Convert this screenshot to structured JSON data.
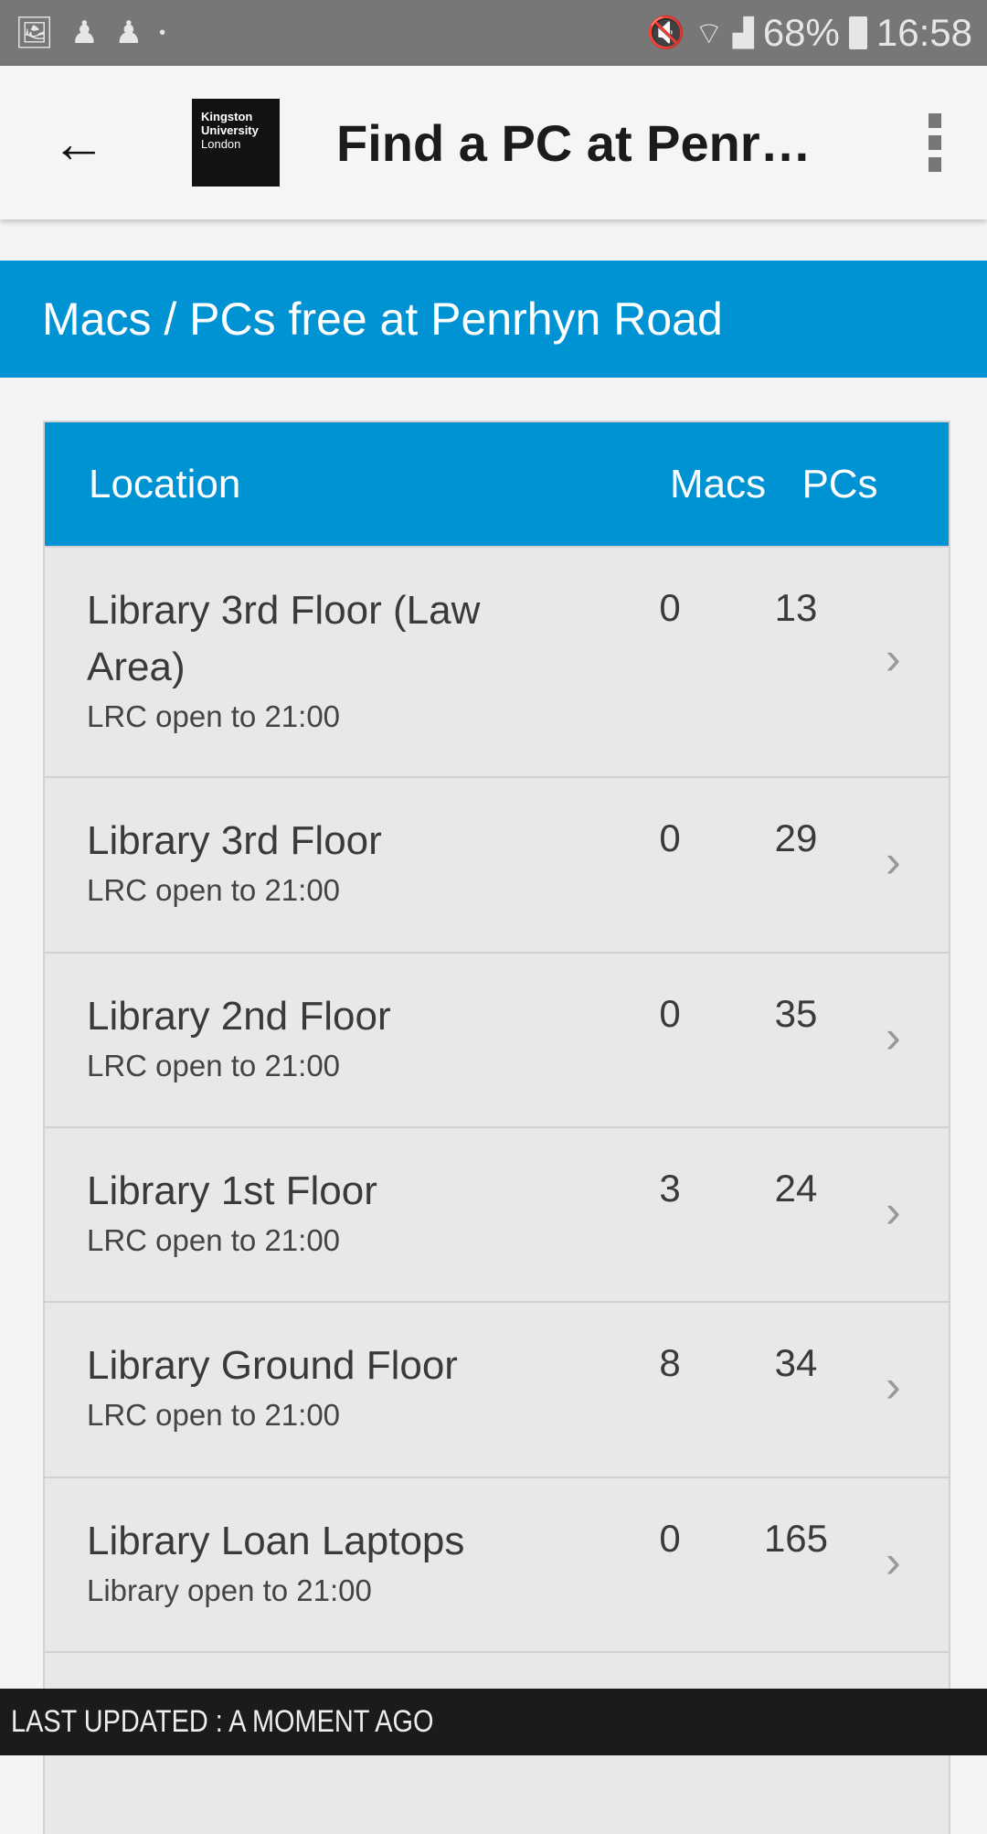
{
  "status_bar": {
    "battery": "68%",
    "time": "16:58",
    "icons": [
      "image-icon",
      "keyhole-icon",
      "keyhole-icon",
      "dot-icon",
      "mute-icon",
      "wifi-icon",
      "signal-icon",
      "battery-icon"
    ]
  },
  "app_bar": {
    "title": "Find a PC at Penrhyn Road",
    "logo": [
      "Kingston",
      "University",
      "London"
    ]
  },
  "banner": "Macs / PCs free at Penrhyn Road",
  "table": {
    "headers": {
      "location": "Location",
      "macs": "Macs",
      "pcs": "PCs"
    },
    "rows": [
      {
        "name": "Library 3rd Floor (Law Area)",
        "sub": "LRC open to 21:00",
        "macs": "0",
        "pcs": "13"
      },
      {
        "name": "Library 3rd Floor",
        "sub": "LRC open to 21:00",
        "macs": "0",
        "pcs": "29"
      },
      {
        "name": "Library 2nd Floor",
        "sub": "LRC open to 21:00",
        "macs": "0",
        "pcs": "35"
      },
      {
        "name": "Library 1st Floor",
        "sub": "LRC open to 21:00",
        "macs": "3",
        "pcs": "24"
      },
      {
        "name": "Library Ground Floor",
        "sub": "LRC open to 21:00",
        "macs": "8",
        "pcs": "34"
      },
      {
        "name": "Library Loan Laptops",
        "sub": "Library open to 21:00",
        "macs": "0",
        "pcs": "165"
      }
    ]
  },
  "footer": "LAST UPDATED : A MOMENT AGO",
  "colors": {
    "accent": "#0093d3",
    "footer": "#1b1b1b",
    "status_bar": "#777777"
  }
}
